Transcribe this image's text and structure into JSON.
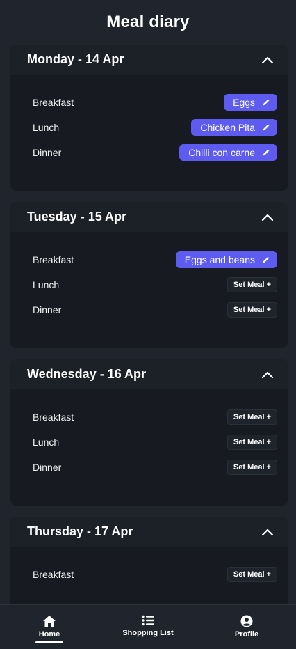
{
  "app": {
    "title": "Meal diary"
  },
  "days": [
    {
      "title": "Monday - 14 Apr",
      "meals": [
        {
          "label": "Breakfast",
          "value": "Eggs",
          "set": true
        },
        {
          "label": "Lunch",
          "value": "Chicken Pita",
          "set": true
        },
        {
          "label": "Dinner",
          "value": "Chilli con carne",
          "set": true
        }
      ]
    },
    {
      "title": "Tuesday - 15 Apr",
      "meals": [
        {
          "label": "Breakfast",
          "value": "Eggs and beans",
          "set": true
        },
        {
          "label": "Lunch",
          "value": "Set Meal +",
          "set": false
        },
        {
          "label": "Dinner",
          "value": "Set Meal +",
          "set": false
        }
      ]
    },
    {
      "title": "Wednesday - 16 Apr",
      "meals": [
        {
          "label": "Breakfast",
          "value": "Set Meal +",
          "set": false
        },
        {
          "label": "Lunch",
          "value": "Set Meal +",
          "set": false
        },
        {
          "label": "Dinner",
          "value": "Set Meal +",
          "set": false
        }
      ]
    },
    {
      "title": "Thursday - 17 Apr",
      "meals": [
        {
          "label": "Breakfast",
          "value": "Set Meal +",
          "set": false
        }
      ]
    }
  ],
  "nav": {
    "items": [
      {
        "label": "Home",
        "icon": "home-icon",
        "active": true
      },
      {
        "label": "Shopping List",
        "icon": "list-icon",
        "active": false
      },
      {
        "label": "Profile",
        "icon": "profile-icon",
        "active": false
      }
    ]
  },
  "colors": {
    "background": "#1f242d",
    "card": "#171b21",
    "accent": "#5e5cf0"
  }
}
